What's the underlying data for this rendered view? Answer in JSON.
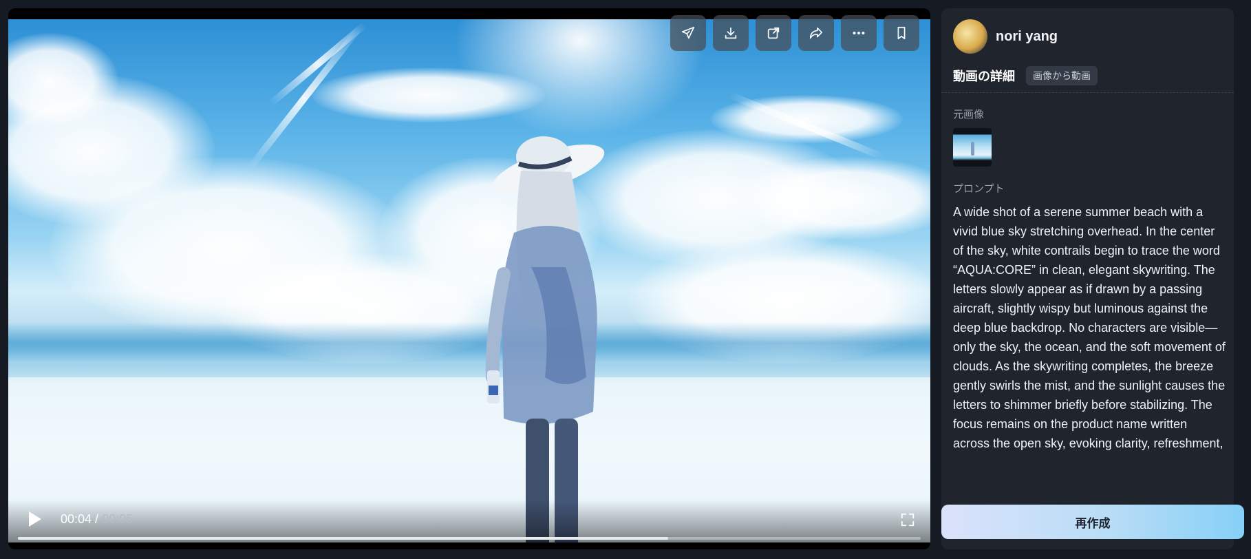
{
  "video": {
    "current_time": "00:04",
    "separator": " / ",
    "duration": "00:05",
    "progress_fraction": 0.72,
    "actions": [
      {
        "name": "send-icon"
      },
      {
        "name": "download-icon"
      },
      {
        "name": "open-external-icon"
      },
      {
        "name": "share-icon"
      },
      {
        "name": "more-icon"
      },
      {
        "name": "bookmark-icon"
      }
    ]
  },
  "user": {
    "name": "nori yang"
  },
  "details": {
    "title": "動画の詳細",
    "mode_badge": "画像から動画",
    "source_label": "元画像",
    "prompt_label": "プロンプト",
    "prompt": "A wide shot of a serene summer beach with a vivid blue sky stretching overhead. In the center of the sky, white contrails begin to trace the word “AQUA:CORE” in clean, elegant skywriting. The letters slowly appear as if drawn by a passing aircraft, slightly wispy but luminous against the deep blue backdrop. No characters are visible—only the sky, the ocean, and the soft movement of clouds. As the skywriting completes, the breeze gently swirls the mist, and the sunlight causes the letters to shimmer briefly before stabilizing. The focus remains on the product name written across the open sky, evoking clarity, refreshment,"
  },
  "recreate_label": "再作成",
  "colors": {
    "background": "#161a23",
    "panel": "#1f242d",
    "accent_gradient_start": "#dbe2fb",
    "accent_gradient_end": "#86d0f7"
  }
}
